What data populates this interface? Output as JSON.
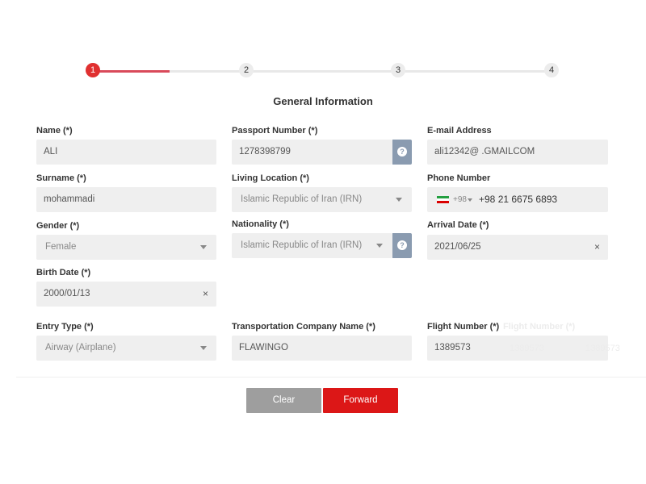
{
  "stepper": {
    "steps": [
      "1",
      "2",
      "3",
      "4"
    ],
    "active_step": 1
  },
  "section_title": "General Information",
  "fields": {
    "name": {
      "label": "Name (*)",
      "value": "ALI"
    },
    "passport_number": {
      "label": "Passport Number (*)",
      "value": "1278398799"
    },
    "email": {
      "label": "E-mail Address",
      "value": "ali12342@ .GMAILCOM"
    },
    "surname": {
      "label": "Surname (*)",
      "value": "mohammadi"
    },
    "living_location": {
      "label": "Living Location (*)",
      "value": "Islamic Republic of Iran (IRN)"
    },
    "phone": {
      "label": "Phone Number",
      "country_code": "+98",
      "value": "+98 21 6675 6893"
    },
    "gender": {
      "label": "Gender (*)",
      "value": "Female"
    },
    "nationality": {
      "label": "Nationality (*)",
      "value": "Islamic Republic of Iran (IRN)"
    },
    "arrival_date": {
      "label": "Arrival Date (*)",
      "value": "2021/06/25"
    },
    "birth_date": {
      "label": "Birth Date (*)",
      "value": "2000/01/13"
    },
    "entry_type": {
      "label": "Entry Type (*)",
      "value": "Airway (Airplane)"
    },
    "transport_company": {
      "label": "Transportation Company Name (*)",
      "value": "FLAWINGO"
    },
    "flight_number": {
      "label": "Flight Number (*)",
      "value": "1389573",
      "ghost_label": "Flight Number (*)",
      "ghost_value": "1389573",
      "ghost_value_2": "1389573"
    }
  },
  "glyphs": {
    "help": "?",
    "clear": "×"
  },
  "icons": {
    "help": "question-circle-icon",
    "dropdown": "chevron-down-icon",
    "clear": "close-icon",
    "flag": "iran-flag-icon"
  },
  "colors": {
    "accent": "#e03030",
    "help_button": "#8a9bb0",
    "clear_button": "#9e9e9e",
    "forward_button": "#dc1717"
  },
  "buttons": {
    "clear": "Clear",
    "forward": "Forward"
  }
}
